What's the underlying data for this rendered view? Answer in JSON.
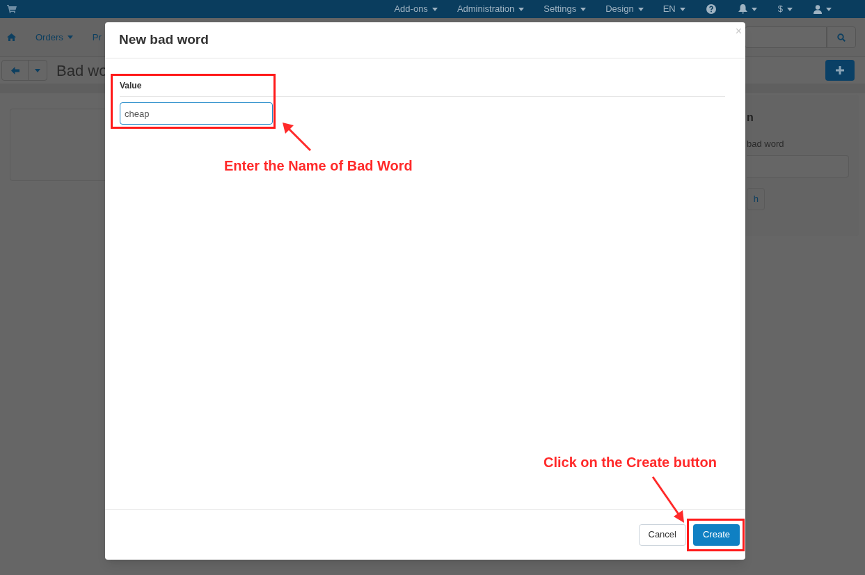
{
  "top_bar": {
    "menus": [
      {
        "label": "Add-ons",
        "kind": "dropdown"
      },
      {
        "label": "Administration",
        "kind": "dropdown"
      },
      {
        "label": "Settings",
        "kind": "dropdown"
      },
      {
        "label": "Design",
        "kind": "dropdown"
      },
      {
        "label": "EN",
        "kind": "dropdown"
      },
      {
        "kind": "help"
      },
      {
        "kind": "bell"
      },
      {
        "label": "$",
        "kind": "dropdown"
      },
      {
        "kind": "user"
      }
    ]
  },
  "nav": {
    "items": [
      "Orders",
      "Pr"
    ]
  },
  "page_title": "Bad wo",
  "sidebar": {
    "heading": "n",
    "field_label": "bad word",
    "button": "h"
  },
  "modal": {
    "title": "New bad word",
    "close": "×",
    "field_label": "Value",
    "field_value": "cheap",
    "buttons": [
      {
        "label": "Cancel",
        "kind": "secondary"
      },
      {
        "label": "Create",
        "kind": "primary"
      }
    ]
  },
  "annotations": [
    "Enter the Name of Bad Word",
    "Click on the Create button"
  ]
}
